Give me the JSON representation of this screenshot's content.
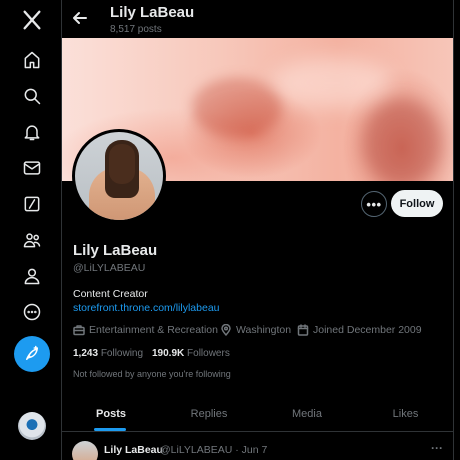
{
  "nav": {
    "items": [
      {
        "icon": "x-logo-icon"
      },
      {
        "icon": "home-icon"
      },
      {
        "icon": "search-icon"
      },
      {
        "icon": "bell-icon"
      },
      {
        "icon": "mail-icon"
      },
      {
        "icon": "grok-icon"
      },
      {
        "icon": "communities-icon"
      },
      {
        "icon": "profile-icon"
      },
      {
        "icon": "more-circle-icon"
      }
    ],
    "post_icon": "feather-icon",
    "accent": "#1d9bf0"
  },
  "header": {
    "name": "Lily LaBeau",
    "post_count": "8,517 posts"
  },
  "profile": {
    "name": "Lily LaBeau",
    "handle": "@LiLYLABEAU",
    "bio": "Content Creator",
    "link": "storefront.throne.com/lilylabeau",
    "category": "Entertainment & Recreation",
    "location": "Washington",
    "joined": "Joined December 2009",
    "following_count": "1,243",
    "following_label": "Following",
    "followers_count": "190.9K",
    "followers_label": "Followers",
    "not_followed": "Not followed by anyone you're following"
  },
  "actions": {
    "more": "•••",
    "follow": "Follow"
  },
  "tabs": [
    {
      "label": "Posts",
      "active": true
    },
    {
      "label": "Replies",
      "active": false
    },
    {
      "label": "Media",
      "active": false
    },
    {
      "label": "Likes",
      "active": false
    }
  ],
  "post": {
    "name": "Lily LaBeau",
    "handle_date": "@LiLYLABEAU · Jun 7",
    "more": "···"
  }
}
